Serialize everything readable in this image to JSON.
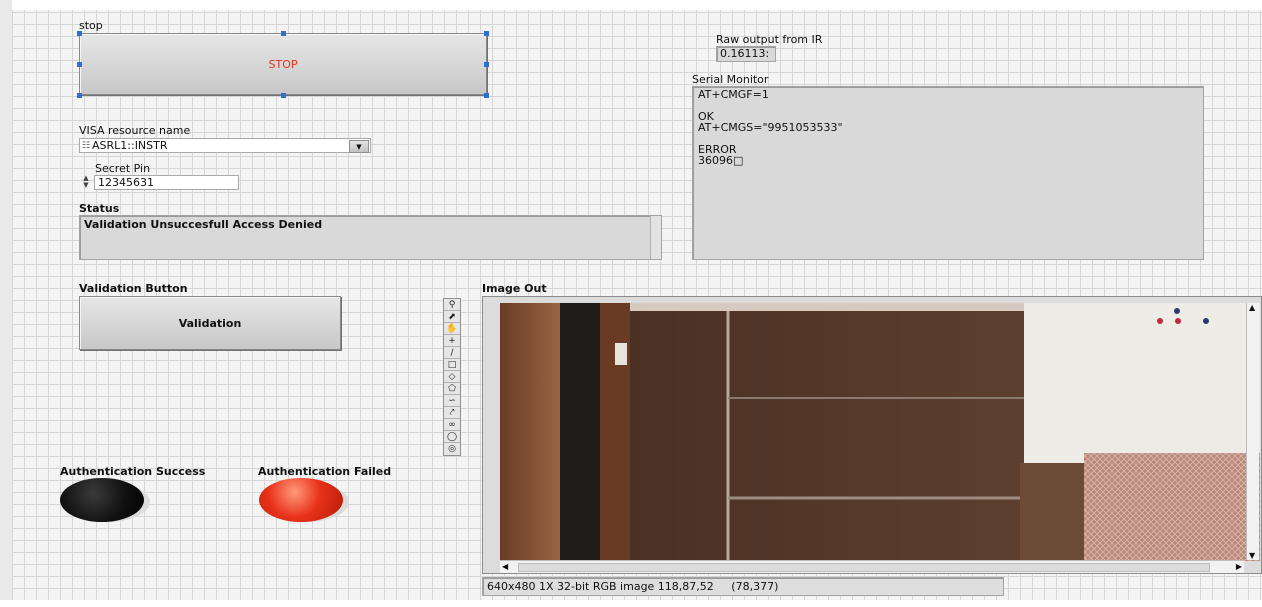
{
  "stop": {
    "label": "stop",
    "button_text": "STOP"
  },
  "raw_output": {
    "label": "Raw output from IR",
    "value": "0.16113:"
  },
  "serial_monitor": {
    "label": "Serial Monitor",
    "lines": [
      "AT+CMGF=1",
      "",
      "OK",
      "AT+CMGS=\"9951053533\"",
      "",
      "ERROR",
      "36096□"
    ]
  },
  "visa": {
    "label": "VISA resource name",
    "value": "ASRL1::INSTR"
  },
  "secret_pin": {
    "label": "Secret Pin",
    "value": "12345631"
  },
  "status": {
    "label": "Status",
    "value": "Validation Unsuccesfull Access Denied"
  },
  "validation": {
    "label": "Validation Button",
    "button_text": "Validation"
  },
  "auth_success": {
    "label": "Authentication Success",
    "color": "#111111"
  },
  "auth_failed": {
    "label": "Authentication Failed",
    "color": "#e8321a"
  },
  "image_out": {
    "label": "Image Out",
    "info": "640x480 1X 32-bit RGB image 118,87,52",
    "coords": "(78,377)"
  },
  "image_tools": [
    "zoom-icon",
    "pointer-icon",
    "pan-icon",
    "crosshair-icon",
    "line-icon",
    "rectangle-icon",
    "rotated-rect-icon",
    "polygon-icon",
    "freehand-icon",
    "polyline-icon",
    "lasso-icon",
    "oval-icon",
    "annulus-icon"
  ],
  "colors": {
    "accent": "#2d6fd8",
    "stop_text": "#e8321a"
  }
}
